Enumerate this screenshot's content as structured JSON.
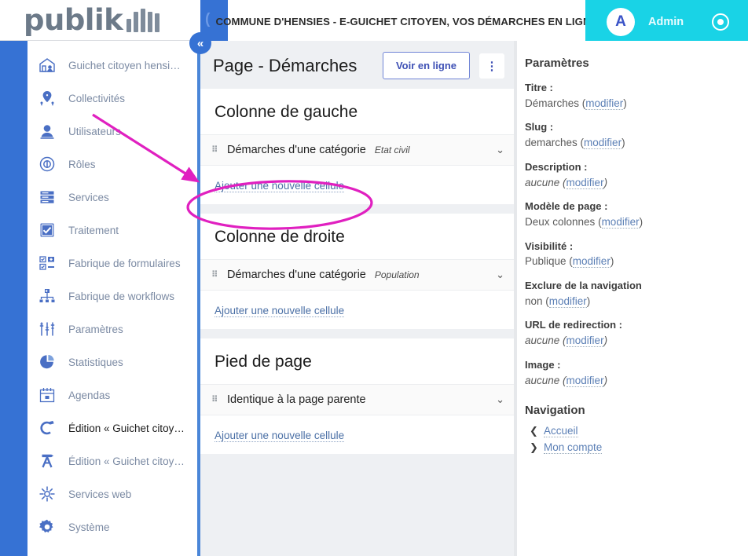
{
  "brand": {
    "name": "publik",
    "logo_bars": 5
  },
  "header": {
    "site_title": "COMMUNE D'HENSIES - E-GUICHET CITOYEN, VOS DÉMARCHES EN LIGNE",
    "user_initial": "A",
    "user_name": "Admin",
    "logout_icon": "power-icon",
    "collapse_icon": "chevron-double-left-icon",
    "accent_cyan": "#19d3e6",
    "accent_blue": "#3672d4"
  },
  "sidebar": {
    "collapse_label": "«",
    "items": [
      {
        "label": "Guichet citoyen hensies - Po...",
        "icon": "home-user-icon",
        "active": false
      },
      {
        "label": "Collectivités",
        "icon": "map-pin-icon",
        "active": false
      },
      {
        "label": "Utilisateurs",
        "icon": "user-icon",
        "active": false
      },
      {
        "label": "Rôles",
        "icon": "role-gear-icon",
        "active": false
      },
      {
        "label": "Services",
        "icon": "server-icon",
        "active": false
      },
      {
        "label": "Traitement",
        "icon": "checkbox-icon",
        "active": false
      },
      {
        "label": "Fabrique de formulaires",
        "icon": "form-builder-icon",
        "active": false
      },
      {
        "label": "Fabrique de workflows",
        "icon": "workflow-icon",
        "active": false
      },
      {
        "label": "Paramètres",
        "icon": "sliders-icon",
        "active": false
      },
      {
        "label": "Statistiques",
        "icon": "pie-chart-icon",
        "active": false
      },
      {
        "label": "Agendas",
        "icon": "calendar-icon",
        "active": false
      },
      {
        "label": "Édition « Guichet citoyen he...",
        "icon": "combo-edit-icon",
        "active": true
      },
      {
        "label": "Édition « Guichet citoyen he...",
        "icon": "authentic-edit-icon",
        "active": false
      },
      {
        "label": "Services web",
        "icon": "web-services-icon",
        "active": false
      },
      {
        "label": "Système",
        "icon": "gear-icon",
        "active": false
      }
    ]
  },
  "main": {
    "page_title": "Page - Démarches",
    "view_online_label": "Voir en ligne",
    "kebab_label": "⋮",
    "sections": [
      {
        "title": "Colonne de gauche",
        "cells": [
          {
            "name": "Démarches d'une catégorie",
            "sub": "Etat civil",
            "chevron": "⌄"
          }
        ],
        "add_label": "Ajouter une nouvelle cellule"
      },
      {
        "title": "Colonne de droite",
        "cells": [
          {
            "name": "Démarches d'une catégorie",
            "sub": "Population",
            "chevron": "⌄"
          }
        ],
        "add_label": "Ajouter une nouvelle cellule"
      },
      {
        "title": "Pied de page",
        "cells": [
          {
            "name": "Identique à la page parente",
            "sub": "",
            "chevron": "⌄"
          }
        ],
        "add_label": "Ajouter une nouvelle cellule"
      }
    ]
  },
  "settings": {
    "heading": "Paramètres",
    "modifier_label": "modifier",
    "fields": [
      {
        "key": "Titre :",
        "value": "Démarches",
        "italic": false
      },
      {
        "key": "Slug :",
        "value": "demarches",
        "italic": false
      },
      {
        "key": "Description :",
        "value": "aucune",
        "italic": true
      },
      {
        "key": "Modèle de page :",
        "value": "Deux colonnes",
        "italic": false
      },
      {
        "key": "Visibilité :",
        "value": "Publique",
        "italic": false
      },
      {
        "key": "Exclure de la navigation",
        "value": "non",
        "italic": false
      },
      {
        "key": "URL de redirection :",
        "value": "aucune",
        "italic": true
      },
      {
        "key": "Image :",
        "value": "aucune",
        "italic": true
      }
    ],
    "nav_heading": "Navigation",
    "nav_links": [
      {
        "arrow": "❮",
        "label": "Accueil"
      },
      {
        "arrow": "❯",
        "label": "Mon compte"
      }
    ]
  },
  "annotation": {
    "color": "#e020c0",
    "arrow": "arrow-to-add-cell",
    "ellipse": "highlight-ellipse-add-cell"
  }
}
